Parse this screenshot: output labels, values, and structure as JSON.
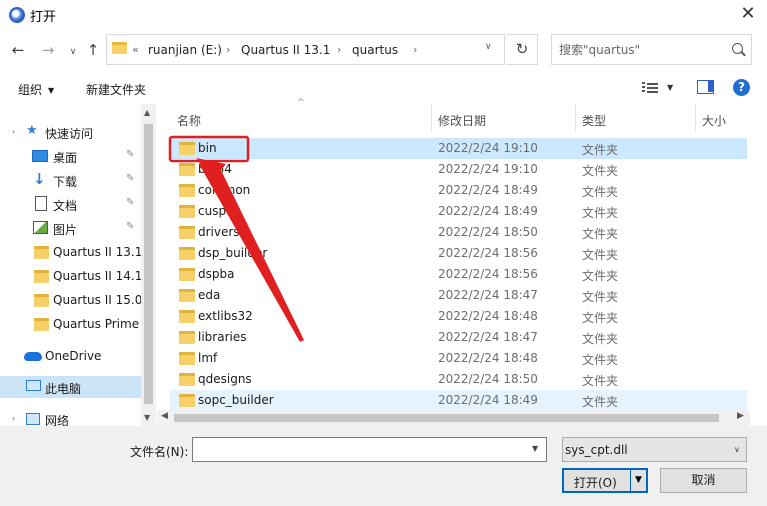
{
  "window": {
    "title": "打开",
    "close_symbol": "✕"
  },
  "nav": {
    "back": "←",
    "forward": "→",
    "history": "∨",
    "up": "↑",
    "refresh": "↻"
  },
  "address": {
    "overflow": "«",
    "crumbs": [
      "ruanjian (E:)",
      "Quartus II 13.1",
      "quartus"
    ],
    "separator": "›"
  },
  "search": {
    "placeholder": "搜索\"quartus\""
  },
  "toolbar": {
    "organize": "组织",
    "new_folder": "新建文件夹",
    "help": "?"
  },
  "sidebar": {
    "quick_access": "快速访问",
    "items": [
      {
        "label": "桌面",
        "icon": "desktop-icon",
        "pinned": true
      },
      {
        "label": "下载",
        "icon": "download-icon",
        "pinned": true
      },
      {
        "label": "文档",
        "icon": "document-icon",
        "pinned": true
      },
      {
        "label": "图片",
        "icon": "picture-icon",
        "pinned": true
      },
      {
        "label": "Quartus II 13.1",
        "icon": "folder-icon",
        "pinned": false
      },
      {
        "label": "Quartus II 14.1",
        "icon": "folder-icon",
        "pinned": false
      },
      {
        "label": "Quartus II 15.0",
        "icon": "folder-icon",
        "pinned": false
      },
      {
        "label": "Quartus Prime",
        "icon": "folder-icon",
        "pinned": false
      }
    ],
    "onedrive": "OneDrive",
    "this_pc": "此电脑",
    "network": "网络",
    "pin_symbol": "📌"
  },
  "columns": {
    "name": "名称",
    "modified": "修改日期",
    "type": "类型",
    "size": "大小"
  },
  "files": [
    {
      "name": "bin",
      "modified": "2022/2/24 19:10",
      "type": "文件夹"
    },
    {
      "name": "bin64",
      "modified": "2022/2/24 19:10",
      "type": "文件夹"
    },
    {
      "name": "common",
      "modified": "2022/2/24 18:49",
      "type": "文件夹"
    },
    {
      "name": "cusp",
      "modified": "2022/2/24 18:49",
      "type": "文件夹"
    },
    {
      "name": "drivers",
      "modified": "2022/2/24 18:50",
      "type": "文件夹"
    },
    {
      "name": "dsp_builder",
      "modified": "2022/2/24 18:56",
      "type": "文件夹"
    },
    {
      "name": "dspba",
      "modified": "2022/2/24 18:56",
      "type": "文件夹"
    },
    {
      "name": "eda",
      "modified": "2022/2/24 18:47",
      "type": "文件夹"
    },
    {
      "name": "extlibs32",
      "modified": "2022/2/24 18:48",
      "type": "文件夹"
    },
    {
      "name": "libraries",
      "modified": "2022/2/24 18:47",
      "type": "文件夹"
    },
    {
      "name": "lmf",
      "modified": "2022/2/24 18:48",
      "type": "文件夹"
    },
    {
      "name": "qdesigns",
      "modified": "2022/2/24 18:50",
      "type": "文件夹"
    },
    {
      "name": "sopc_builder",
      "modified": "2022/2/24 18:49",
      "type": "文件夹"
    }
  ],
  "selected_index": 0,
  "hover_index": 12,
  "annotation": {
    "highlight_color": "#e02020",
    "target": "bin"
  },
  "bottom": {
    "filename_label": "文件名(N):",
    "filename_value": "",
    "filter": "sys_cpt.dll",
    "open": "打开(O)",
    "cancel": "取消"
  },
  "colors": {
    "selection": "#cce8ff",
    "accent": "#0067c0",
    "folder": "#f6d16a"
  }
}
